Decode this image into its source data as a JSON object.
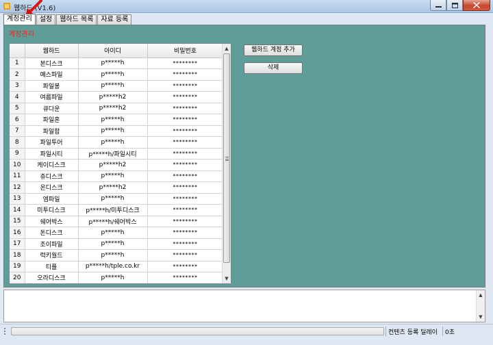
{
  "window": {
    "title": "웹하드 (V1.6)",
    "accent_color": "#5f9d99"
  },
  "tabs": [
    {
      "label": "계정관리",
      "active": true
    },
    {
      "label": "설정",
      "active": false
    },
    {
      "label": "웹하드 목록",
      "active": false
    },
    {
      "label": "자료 등록",
      "active": false
    }
  ],
  "panel": {
    "label": "계정관리"
  },
  "grid": {
    "columns": [
      "",
      "웹하드",
      "아이디",
      "비밀번호"
    ],
    "rows": [
      {
        "n": "1",
        "site": "본디스크",
        "id": "p*****h",
        "pw": "********"
      },
      {
        "n": "2",
        "site": "예스파일",
        "id": "p*****h",
        "pw": "********"
      },
      {
        "n": "3",
        "site": "파일봉",
        "id": "p*****h",
        "pw": "********"
      },
      {
        "n": "4",
        "site": "여름파일",
        "id": "p*****h2",
        "pw": "********"
      },
      {
        "n": "5",
        "site": "큐다운",
        "id": "p*****h2",
        "pw": "********"
      },
      {
        "n": "6",
        "site": "파일혼",
        "id": "p*****h",
        "pw": "********"
      },
      {
        "n": "7",
        "site": "파일함",
        "id": "p*****h",
        "pw": "********"
      },
      {
        "n": "8",
        "site": "파일투어",
        "id": "p*****h",
        "pw": "********"
      },
      {
        "n": "9",
        "site": "파일시티",
        "id": "p*****h/파일시티",
        "pw": "********"
      },
      {
        "n": "10",
        "site": "케이디스크",
        "id": "p*****h2",
        "pw": "********"
      },
      {
        "n": "11",
        "site": "쥬디스크",
        "id": "p*****h",
        "pw": "********"
      },
      {
        "n": "12",
        "site": "온디스크",
        "id": "p*****h2",
        "pw": "********"
      },
      {
        "n": "13",
        "site": "엠파일",
        "id": "p*****h",
        "pw": "********"
      },
      {
        "n": "14",
        "site": "미투디스크",
        "id": "p*****h/미투디스크",
        "pw": "********"
      },
      {
        "n": "15",
        "site": "쉐어박스",
        "id": "p*****h/쉐어박스",
        "pw": "********"
      },
      {
        "n": "16",
        "site": "돈디스크",
        "id": "p*****h",
        "pw": "********"
      },
      {
        "n": "17",
        "site": "조이파일",
        "id": "p*****h",
        "pw": "********"
      },
      {
        "n": "18",
        "site": "럭키월드",
        "id": "p*****h",
        "pw": "********"
      },
      {
        "n": "19",
        "site": "티플",
        "id": "p*****h/tple.co.kr",
        "pw": "********"
      },
      {
        "n": "20",
        "site": "오라디스크",
        "id": "p*****h",
        "pw": "********"
      }
    ]
  },
  "buttons": {
    "add_account": "웹하드 계정 추가",
    "delete": "삭제"
  },
  "statusbar": {
    "delay_label": "컨텐츠 등록 딜레이",
    "delay_value": "0초"
  },
  "icons": {
    "app": "app-icon",
    "minimize": "minimize-icon",
    "maximize": "maximize-icon",
    "close": "close-icon",
    "annotation": "red-arrow-icon"
  }
}
